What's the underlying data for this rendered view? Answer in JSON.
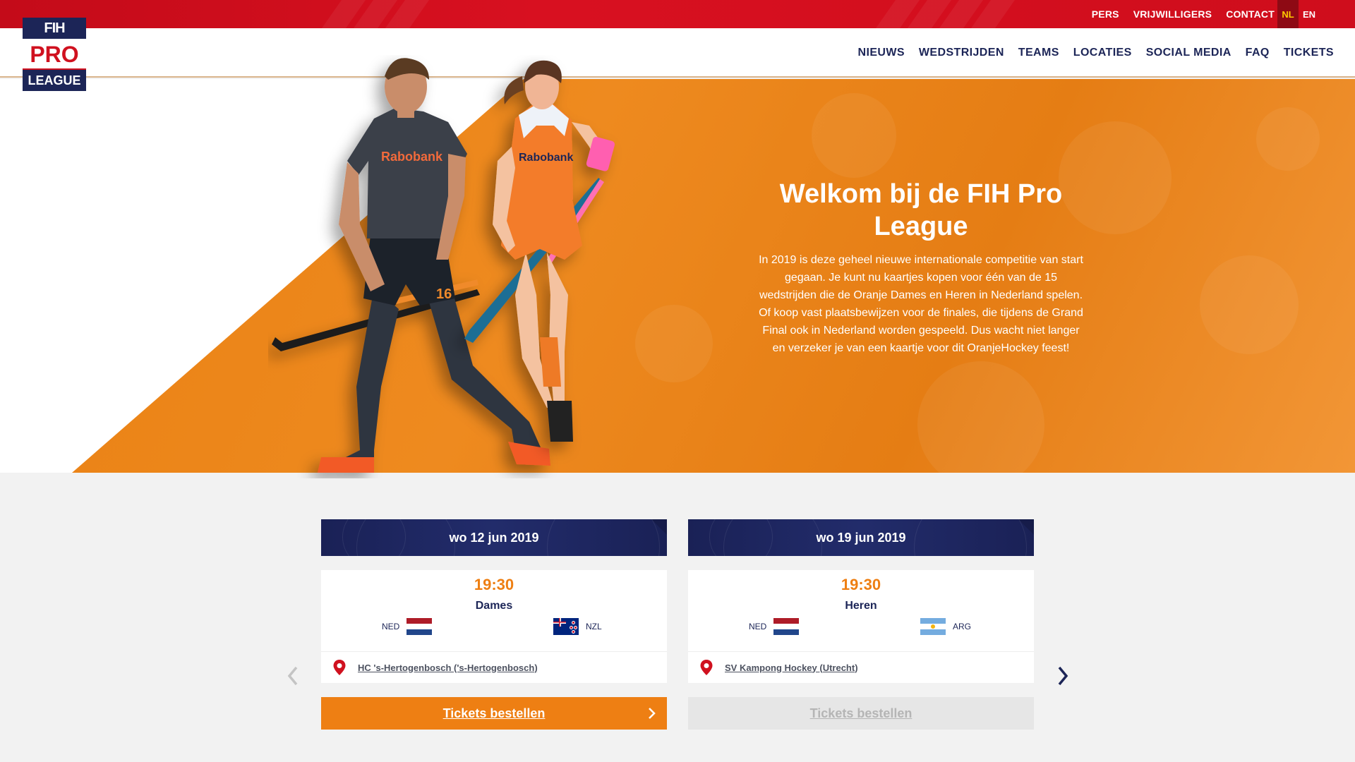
{
  "topbar": {
    "links": [
      "PERS",
      "VRIJWILLIGERS",
      "CONTACT"
    ],
    "languages": [
      {
        "code": "NL",
        "active": true
      },
      {
        "code": "EN",
        "active": false
      }
    ]
  },
  "logo": {
    "line1": "FIH",
    "line2": "PRO",
    "line3": "LEAGUE"
  },
  "nav": {
    "items": [
      "NIEUWS",
      "WEDSTRIJDEN",
      "TEAMS",
      "LOCATIES",
      "SOCIAL MEDIA",
      "FAQ",
      "TICKETS"
    ]
  },
  "hero": {
    "title": "Welkom bij de FIH Pro League",
    "text": "In 2019 is deze geheel nieuwe internationale competitie van start gegaan. Je kunt nu kaartjes kopen voor één van de 15 wedstrijden die de Oranje Dames en Heren in Nederland spelen. Of koop vast plaatsbewijzen voor de finales, die tijdens de Grand Final ook in Nederland worden gespeeld. Dus wacht niet langer en verzeker je van een kaartje voor dit OranjeHockey feest!",
    "player1_shirt": "Rabobank",
    "player1_number": "16",
    "player2_shirt": "Rabobank"
  },
  "matches": [
    {
      "date": "wo 12 jun 2019",
      "time": "19:30",
      "category": "Dames",
      "home": "NED",
      "away": "NZL",
      "location": "HC 's-Hertogenbosch ('s-Hertogenbosch)",
      "button": "Tickets bestellen",
      "button_enabled": true
    },
    {
      "date": "wo 19 jun 2019",
      "time": "19:30",
      "category": "Heren",
      "home": "NED",
      "away": "ARG",
      "location": "SV Kampong Hockey (Utrecht)",
      "button": "Tickets bestellen",
      "button_enabled": false
    }
  ],
  "colors": {
    "orange": "#ee7f13",
    "navy": "#1c2557",
    "red": "#d0111f"
  }
}
